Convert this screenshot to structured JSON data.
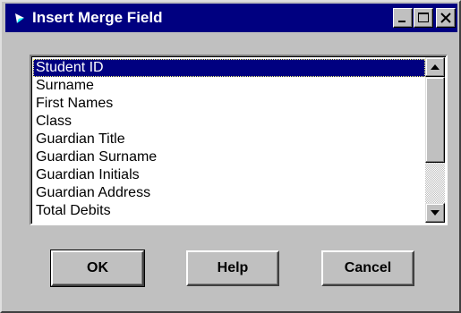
{
  "window": {
    "title": "Insert Merge Field"
  },
  "titlebar_buttons": {
    "minimize": "minimize-icon",
    "maximize": "maximize-icon",
    "close": "close-icon"
  },
  "field_list": {
    "items": [
      "Student ID",
      "Surname",
      "First Names",
      "Class",
      "Guardian Title",
      "Guardian Surname",
      "Guardian Initials",
      "Guardian Address",
      "Total Debits"
    ],
    "selected": "Student ID"
  },
  "buttons": {
    "ok": "OK",
    "help": "Help",
    "cancel": "Cancel"
  },
  "colors": {
    "titlebar": "#000080",
    "face": "#c0c0c0",
    "selection": "#000080"
  }
}
